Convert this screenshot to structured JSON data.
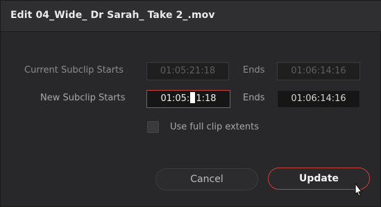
{
  "dialog": {
    "title": "Edit 04_Wide_ Dr Sarah_ Take 2_.mov"
  },
  "current_subclip": {
    "label": "Current Subclip Starts",
    "start_value": "01:05:21:18",
    "ends_label": "Ends",
    "end_value": "01:06:14:16"
  },
  "new_subclip": {
    "label": "New Subclip Starts",
    "start_value_before_cursor": "01:05:",
    "start_value_after_cursor": "1:18",
    "ends_label": "Ends",
    "end_value": "01:06:14:16"
  },
  "options": {
    "full_clip_label": "Use full clip extents",
    "full_clip_checked": false
  },
  "buttons": {
    "cancel_label": "Cancel",
    "update_label": "Update"
  },
  "colors": {
    "accent": "#c8423b",
    "background": "#28282a",
    "titlebar": "#2f2f31"
  }
}
